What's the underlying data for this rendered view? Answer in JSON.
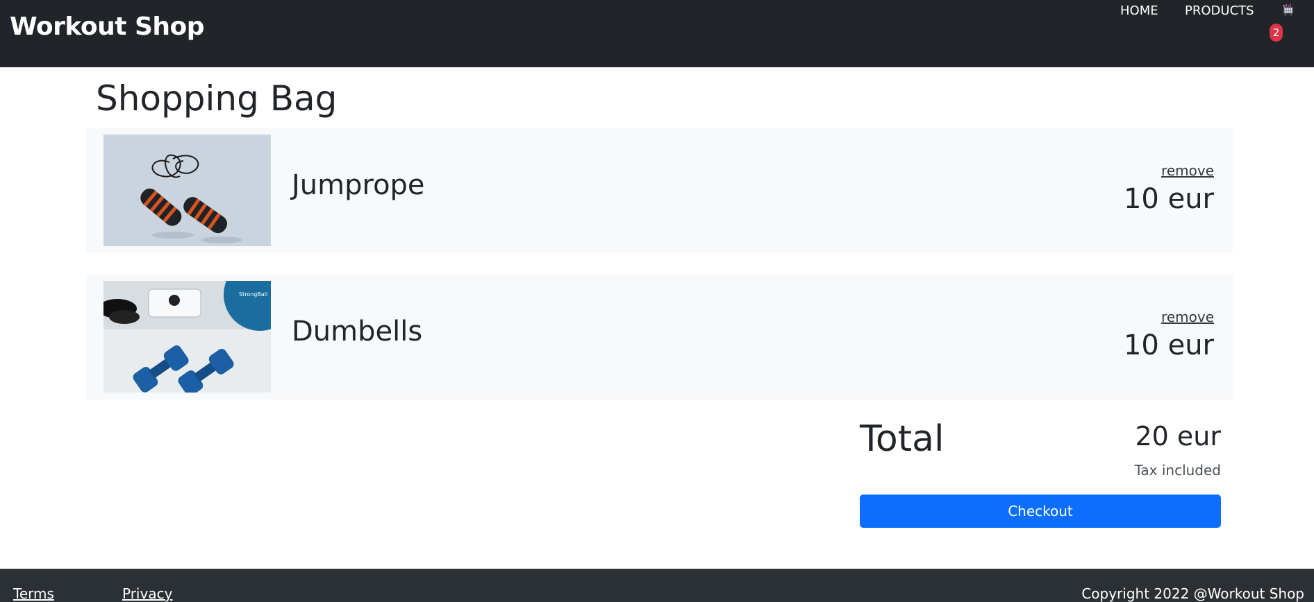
{
  "header": {
    "brand": "Workout Shop",
    "nav": {
      "home": "HOME",
      "products": "PRODUCTS"
    },
    "cart": {
      "icon": "shopping-cart-icon",
      "count": "2"
    }
  },
  "page": {
    "title": "Shopping Bag"
  },
  "bag": {
    "items": [
      {
        "name": "Jumprope",
        "remove_label": "remove",
        "price": "10 eur",
        "image": "jumprope-image"
      },
      {
        "name": "Dumbells",
        "remove_label": "remove",
        "price": "10 eur",
        "image": "dumbbells-image"
      }
    ]
  },
  "summary": {
    "total_label": "Total",
    "total_value": "20 eur",
    "tax_note": "Tax included",
    "checkout_label": "Checkout"
  },
  "footer": {
    "terms": "Terms",
    "privacy": "Privacy",
    "copyright": "Copyright 2022 @Workout Shop"
  },
  "colors": {
    "navbar": "#212529",
    "footer": "#2b3035",
    "primary": "#0d6efd",
    "badge": "#dc3545",
    "row_bg": "#f8f9fa"
  }
}
